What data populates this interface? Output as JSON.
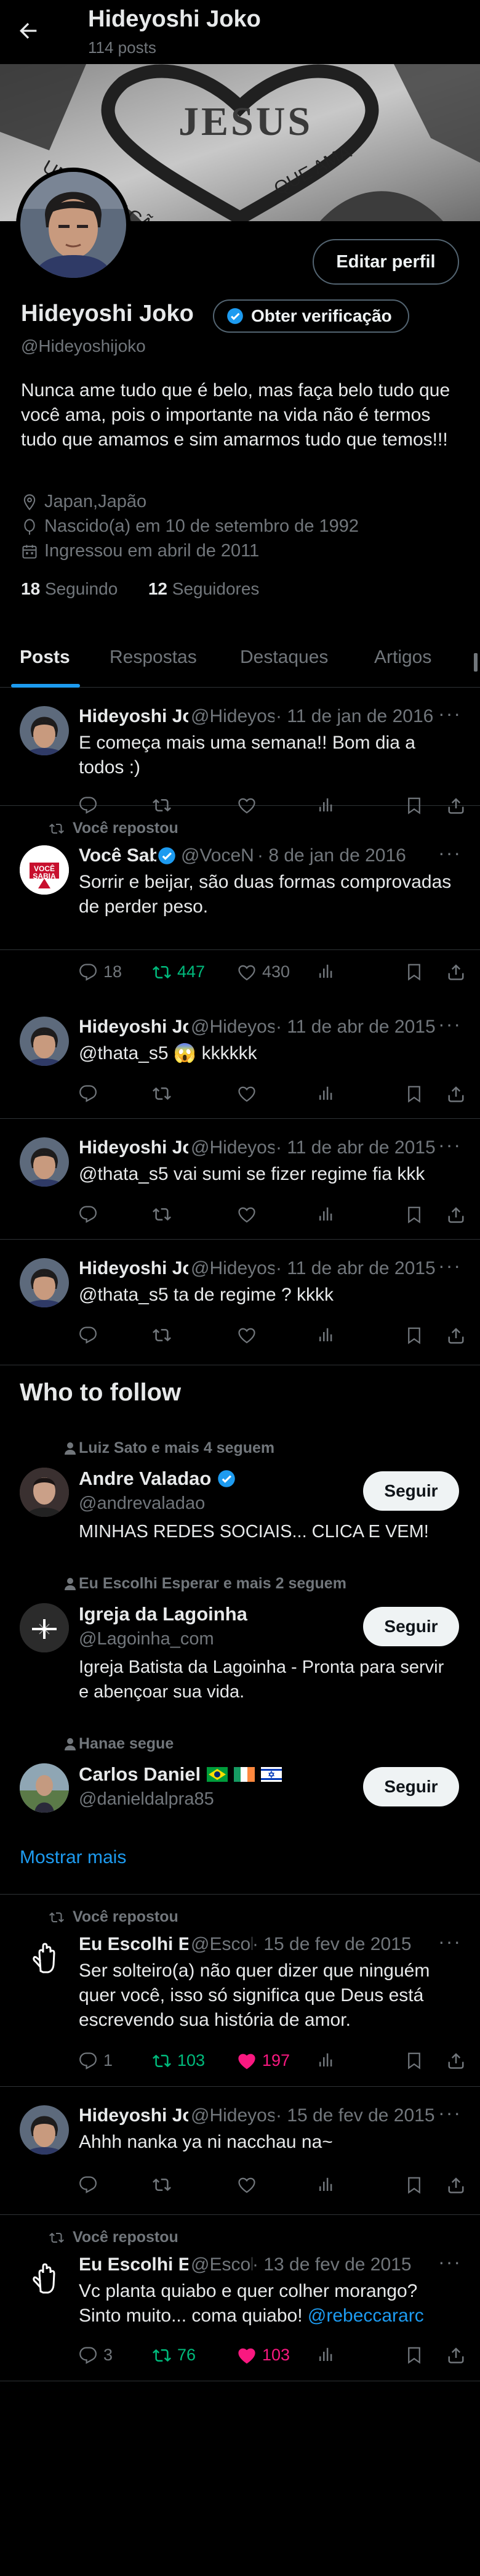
{
  "header": {
    "title": "Hideyoshi Joko",
    "posts_count": "114 posts",
    "back_icon": "arrow-left-icon"
  },
  "banner": {
    "text_main": "JESUS",
    "text_left": "UMA GERAÇÃO",
    "text_right": "QUE AMA"
  },
  "profile": {
    "name": "Hideyoshi Joko",
    "verify_label": "Obter verificação",
    "handle": "@Hideyoshijoko",
    "edit_label": "Editar perfil",
    "bio": "Nunca ame tudo que é belo, mas faça belo tudo que você ama, pois o importante na vida não é termos tudo que amamos e sim amarmos tudo que temos!!!",
    "location": "Japan,Japão",
    "birth": "Nascido(a) em 10 de setembro de 1992",
    "joined": "Ingressou em abril de 2011",
    "following_count": "18",
    "following_label": "Seguindo",
    "followers_count": "12",
    "followers_label": "Seguidores"
  },
  "tabs": [
    {
      "label": "Posts",
      "active": true
    },
    {
      "label": "Respostas"
    },
    {
      "label": "Destaques"
    },
    {
      "label": "Artigos"
    }
  ],
  "tweets": [
    {
      "name": "Hideyoshi Joko",
      "handle": "@Hideyoshijoko",
      "date": "· 11 de jan de 2016",
      "text": "E começa mais uma semana!! Bom dia a todos :)",
      "replies": "",
      "reposts": "",
      "likes": ""
    },
    {
      "repost_label": "Você repostou",
      "name": "Você Sabia?",
      "handle": "@VoceNaoSabia",
      "date": "· 8 de jan de 2016",
      "text": "Sorrir e beijar, são duas formas comprovadas de perder peso.",
      "replies": "18",
      "reposts": "447",
      "likes": "430",
      "avatar_text": "VOCÊ SABIA"
    },
    {
      "name": "Hideyoshi Joko",
      "handle": "@Hideyoshijoko",
      "date": "· 11 de abr de 2015",
      "text": "@thata_s5 😱 kkkkkk",
      "replies": "",
      "reposts": "",
      "likes": ""
    },
    {
      "name": "Hideyoshi Joko",
      "handle": "@Hideyoshijoko",
      "date": "· 11 de abr de 2015",
      "text": "@thata_s5 vai sumi se fizer regime fia kkk",
      "replies": "",
      "reposts": "",
      "likes": ""
    },
    {
      "name": "Hideyoshi Joko",
      "handle": "@Hideyoshijoko",
      "date": "· 11 de abr de 2015",
      "text": "@thata_s5 ta de regime ? kkkk",
      "replies": "",
      "reposts": "",
      "likes": ""
    },
    {
      "repost_label": "Você repostou",
      "name": "Eu Escolhi Esperar",
      "handle": "@EscolhiEsperar",
      "date": "· 15 de fev de 2015",
      "text": "Ser solteiro(a) não quer dizer que ninguém quer você, isso só significa que Deus está escrevendo sua história de amor.",
      "replies": "1",
      "reposts": "103",
      "likes": "197"
    },
    {
      "name": "Hideyoshi Joko",
      "handle": "@Hideyoshijoko",
      "date": "· 15 de fev de 2015",
      "text": "Ahhh nanka ya ni nacchau na~",
      "replies": "",
      "reposts": "",
      "likes": ""
    },
    {
      "repost_label": "Você repostou",
      "name": "Eu Escolhi Esperar",
      "handle": "@EscolhiEsperar",
      "date": "· 13 de fev de 2015",
      "text": "Vc planta quiabo e quer colher morango? Sinto muito... coma quiabo! ",
      "mention": "@rebeccararc",
      "replies": "3",
      "reposts": "76",
      "likes": "103"
    }
  ],
  "who_to_follow": {
    "title": "Who to follow",
    "show_more": "Mostrar mais",
    "follow_label": "Seguir",
    "items": [
      {
        "context": "Luiz Sato e mais 4 seguem",
        "name": "Andre Valadao",
        "handle": "@andrevaladao",
        "bio": "MINHAS REDES SOCIAIS... CLICA E VEM!"
      },
      {
        "context": "Eu Escolhi Esperar e mais 2 seguem",
        "name": "Igreja da Lagoinha",
        "handle": "@Lagoinha_com",
        "bio": "Igreja Batista da Lagoinha - Pronta para servir e abençoar sua vida."
      },
      {
        "context": "Hanae segue",
        "name": "Carlos Daniel",
        "handle": "@danieldalpra85",
        "bio": ""
      }
    ]
  },
  "colors": {
    "accent": "#1d9bf0",
    "repost_green": "#00ba7c",
    "like_pink": "#f91880",
    "muted": "#71767b",
    "border": "#2f3336"
  }
}
